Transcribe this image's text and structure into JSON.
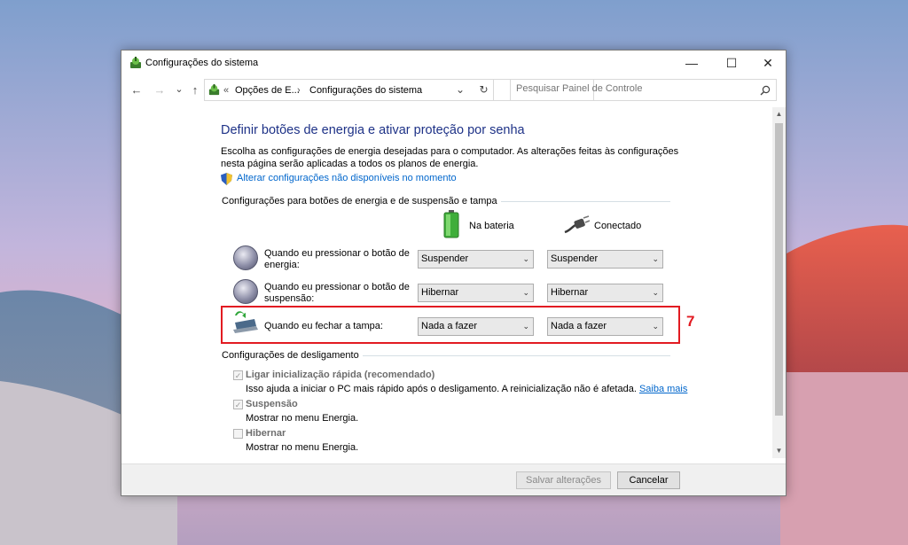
{
  "window": {
    "title": "Configurações do sistema",
    "minimize": "—",
    "maximize": "☐",
    "close": "✕"
  },
  "nav": {
    "back": "←",
    "forward": "→",
    "recent": "⌄",
    "up": "↑",
    "address_prefix": "«",
    "crumb_1": "Opções de E...",
    "crumb_separator": "›",
    "crumb_2": "Configurações do sistema",
    "address_dropdown": "⌄",
    "refresh": "↻",
    "search_placeholder": "Pesquisar Painel de Controle"
  },
  "content": {
    "heading": "Definir botões de energia e ativar proteção por senha",
    "description": "Escolha as configurações de energia desejadas para o computador. As alterações feitas às configurações nesta página serão aplicadas a todos os planos de energia.",
    "change_unavailable_link": "Alterar configurações não disponíveis no momento",
    "buttons_section": "Configurações para botões de energia e de suspensão e tampa",
    "col_battery": "Na bateria",
    "col_plugged": "Conectado",
    "rows": [
      {
        "label": "Quando eu pressionar o botão de energia:",
        "battery": "Suspender",
        "plugged": "Suspender"
      },
      {
        "label": "Quando eu pressionar o botão de suspensão:",
        "battery": "Hibernar",
        "plugged": "Hibernar"
      },
      {
        "label": "Quando eu fechar a tampa:",
        "battery": "Nada a fazer",
        "plugged": "Nada a fazer"
      }
    ],
    "annotation": "7",
    "shutdown_section": "Configurações de desligamento",
    "options": [
      {
        "label": "Ligar inicialização rápida (recomendado)",
        "checked": true,
        "desc": "Isso ajuda a iniciar o PC mais rápido após o desligamento. A reinicialização não é afetada.",
        "link": "Saiba mais"
      },
      {
        "label": "Suspensão",
        "checked": true,
        "desc": "Mostrar no menu Energia."
      },
      {
        "label": "Hibernar",
        "checked": false,
        "desc": "Mostrar no menu Energia."
      }
    ],
    "check_mark": "✓"
  },
  "footer": {
    "save": "Salvar alterações",
    "cancel": "Cancelar"
  },
  "scroll": {
    "up": "▲",
    "down": "▼"
  }
}
